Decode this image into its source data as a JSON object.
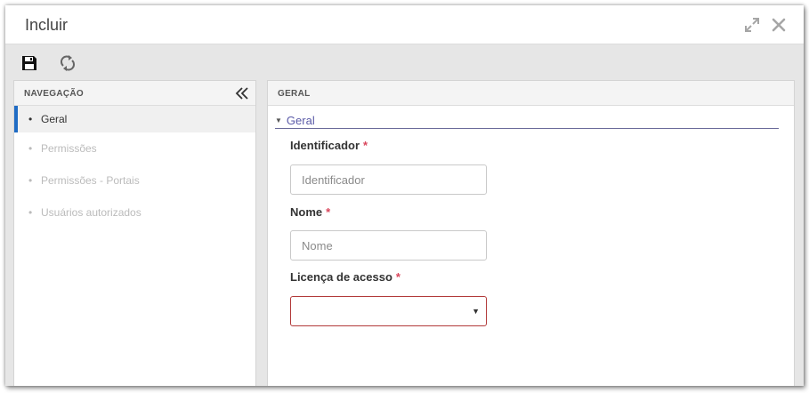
{
  "window": {
    "title": "Incluir",
    "buttons": {
      "expand_icon": "expand-icon",
      "close_icon": "close-icon"
    }
  },
  "toolbar": {
    "save_icon": "save-icon",
    "refresh_icon": "refresh-icon"
  },
  "navigation": {
    "header": "NAVEGAÇÃO",
    "collapse_icon": "double-chevron-left-icon",
    "items": [
      {
        "label": "Geral",
        "active": true
      },
      {
        "label": "Permissões",
        "active": false
      },
      {
        "label": "Permissões - Portais",
        "active": false
      },
      {
        "label": "Usuários autorizados",
        "active": false
      }
    ]
  },
  "main": {
    "header": "GERAL",
    "section": {
      "title": "Geral"
    },
    "fields": {
      "identificador": {
        "label": "Identificador",
        "required": "*",
        "placeholder": "Identificador",
        "value": ""
      },
      "nome": {
        "label": "Nome",
        "required": "*",
        "placeholder": "Nome",
        "value": ""
      },
      "licenca": {
        "label": "Licença de acesso",
        "required": "*",
        "selected": ""
      }
    }
  },
  "colors": {
    "active_indicator": "#1f6bc4",
    "section_link": "#5a5aa8",
    "required": "#d9455b",
    "invalid_border": "#b23a3a"
  }
}
